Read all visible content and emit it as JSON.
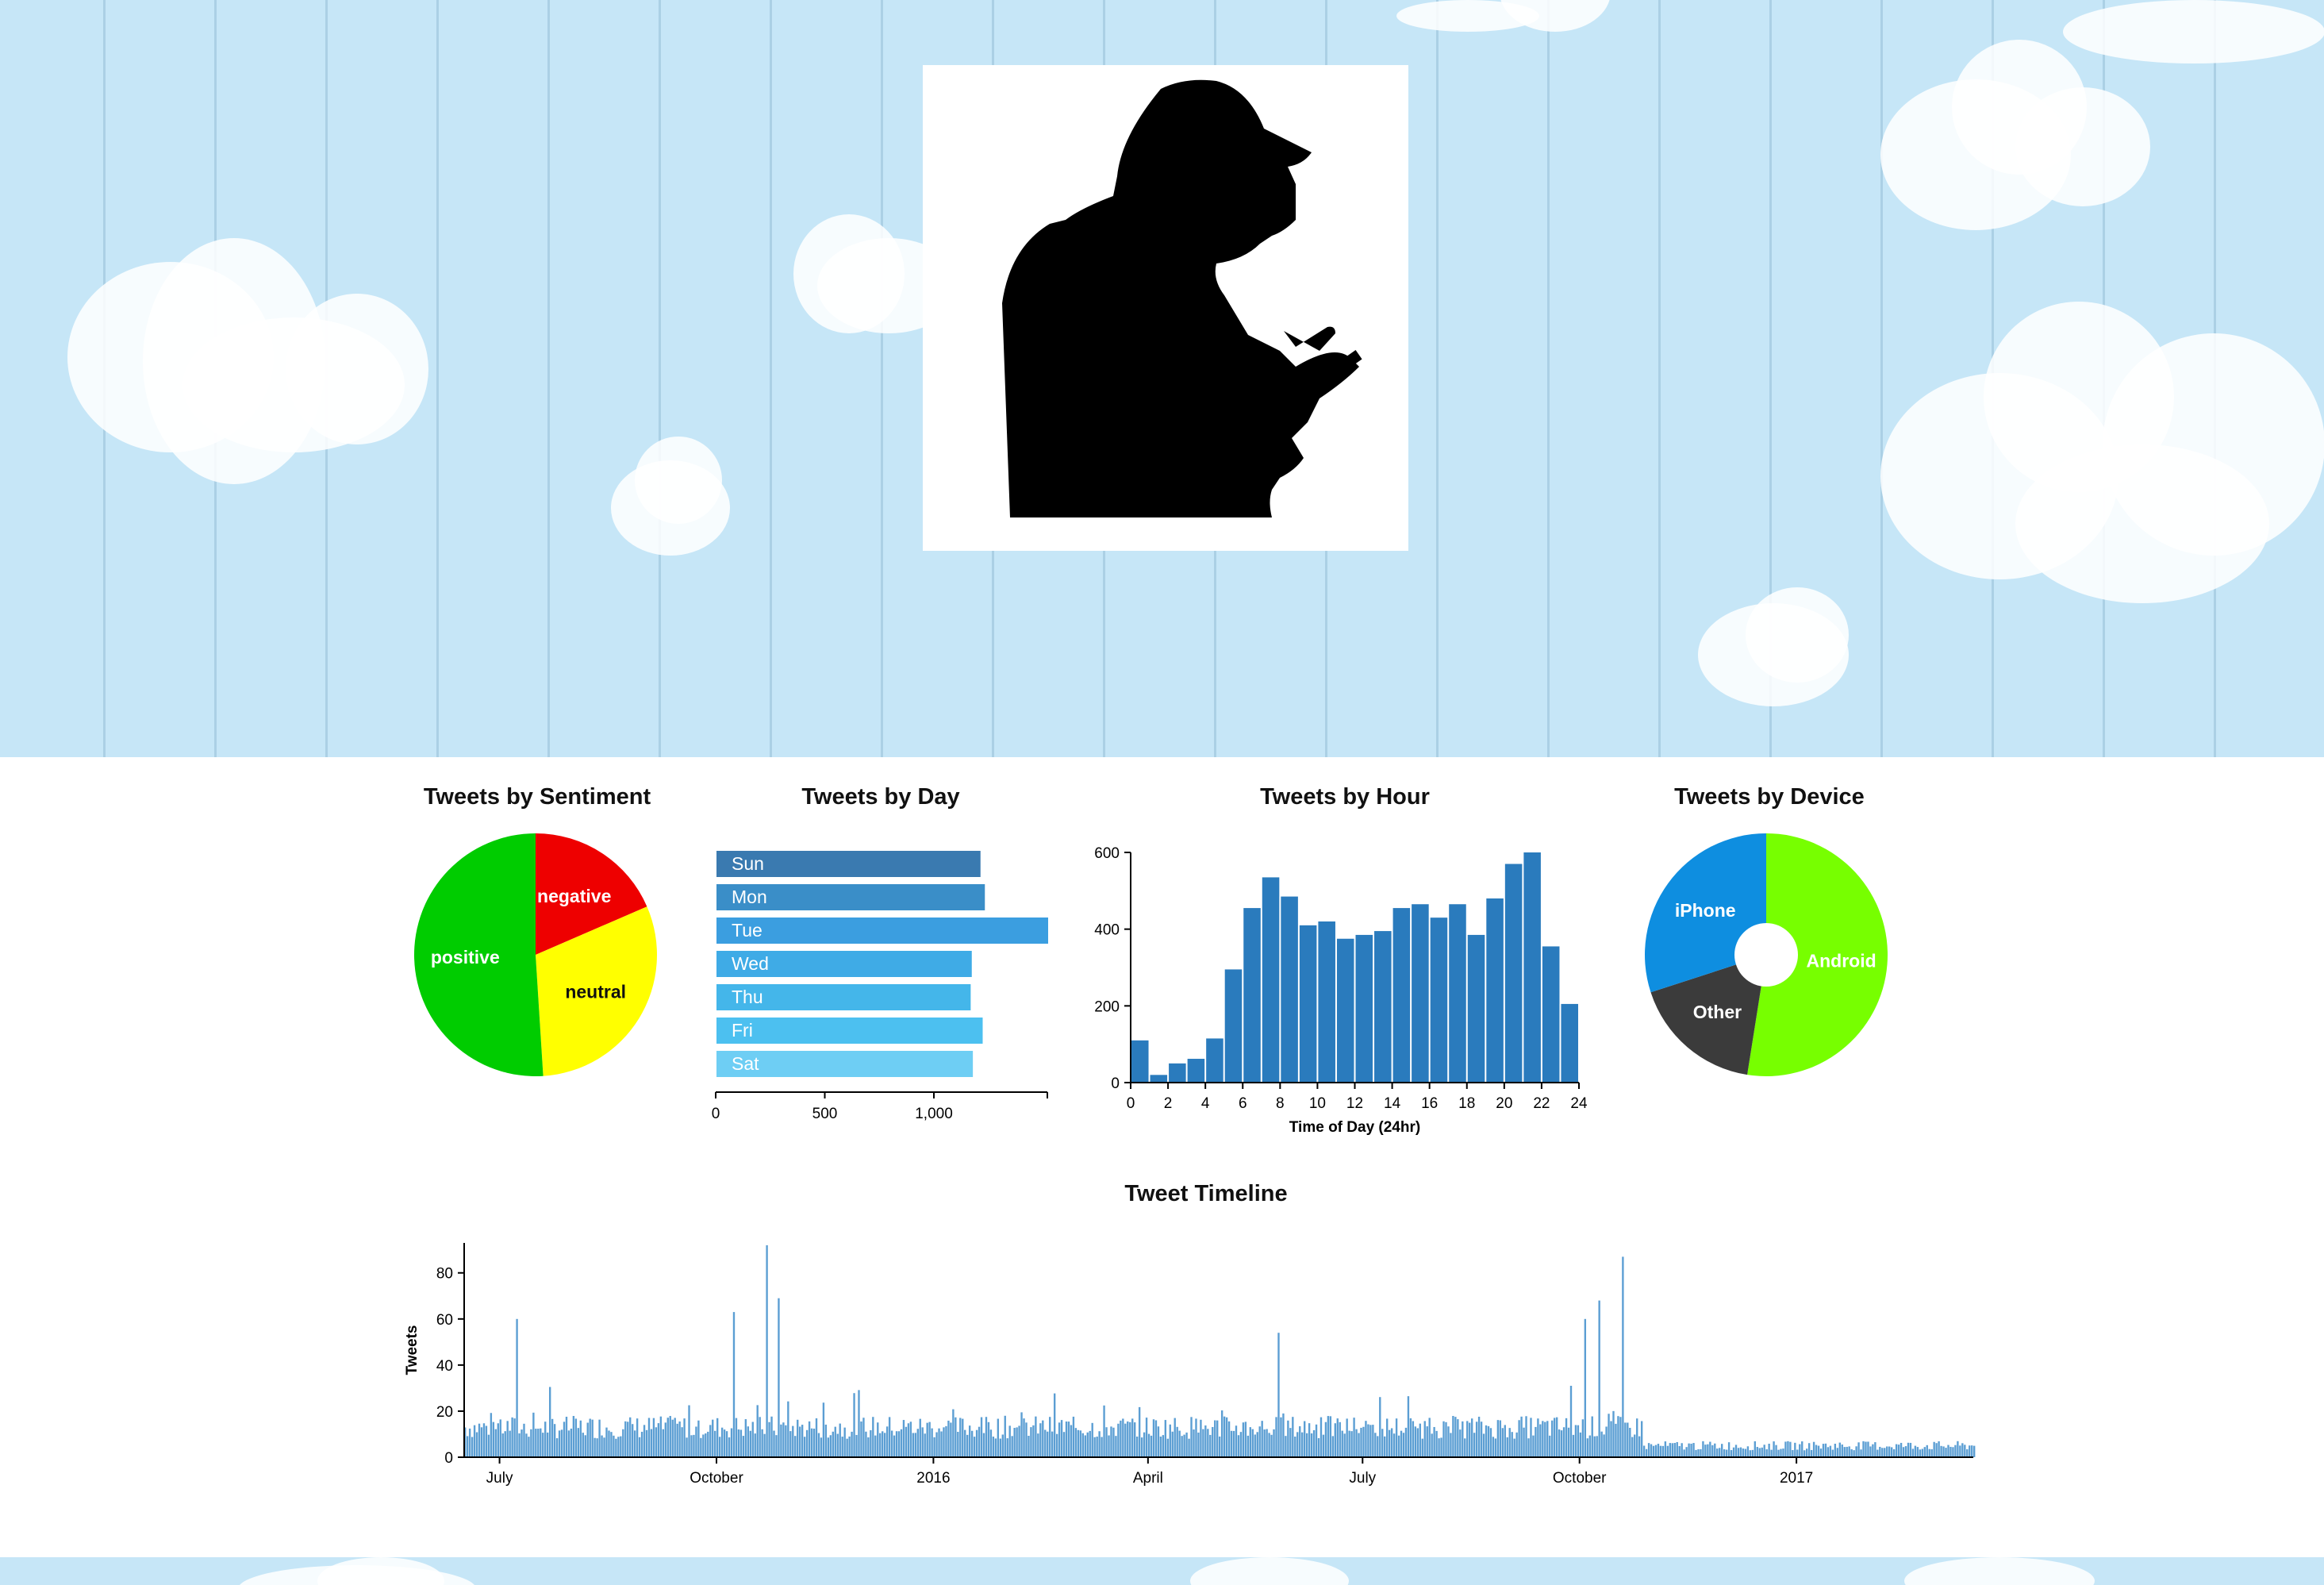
{
  "charts": {
    "sentiment": {
      "title": "Tweets by Sentiment"
    },
    "day": {
      "title": "Tweets by Day"
    },
    "hour": {
      "title": "Tweets by Hour",
      "xlabel": "Time of Day (24hr)"
    },
    "device": {
      "title": "Tweets by Device"
    },
    "timeline": {
      "title": "Tweet Timeline",
      "ylabel": "Tweets"
    }
  },
  "chart_data": [
    {
      "type": "pie",
      "title": "Tweets by Sentiment",
      "labels": [
        "negative",
        "neutral",
        "positive"
      ],
      "values": [
        18.5,
        30.5,
        51
      ],
      "colors": [
        "#ee0000",
        "#ffff00",
        "#00cc00"
      ],
      "label_colors": [
        "#ffffff",
        "#111111",
        "#ffffff"
      ]
    },
    {
      "type": "bar",
      "orientation": "horizontal",
      "title": "Tweets by Day",
      "categories": [
        "Sun",
        "Mon",
        "Tue",
        "Wed",
        "Thu",
        "Fri",
        "Sat"
      ],
      "values": [
        1210,
        1230,
        1520,
        1170,
        1165,
        1220,
        1175
      ],
      "colors": [
        "#3a7ab0",
        "#3a8ec8",
        "#3b9ee0",
        "#3fabe6",
        "#44b6ea",
        "#4cc0f0",
        "#6ecef4"
      ],
      "xticks": [
        0,
        500,
        1000
      ],
      "xtick_labels": [
        "0",
        "500",
        "1,000"
      ],
      "xlim": [
        0,
        1520
      ]
    },
    {
      "type": "bar",
      "title": "Tweets by Hour",
      "xlabel": "Time of Day (24hr)",
      "x": [
        0,
        1,
        2,
        3,
        4,
        5,
        6,
        7,
        8,
        9,
        10,
        11,
        12,
        13,
        14,
        15,
        16,
        17,
        18,
        19,
        20,
        21,
        22,
        23
      ],
      "values": [
        110,
        20,
        50,
        62,
        115,
        295,
        455,
        535,
        485,
        410,
        420,
        375,
        385,
        395,
        455,
        465,
        430,
        465,
        385,
        480,
        570,
        600,
        355,
        205
      ],
      "color": "#2a7bbd",
      "yticks": [
        0,
        200,
        400,
        600
      ],
      "xticks": [
        0,
        2,
        4,
        6,
        8,
        10,
        12,
        14,
        16,
        18,
        20,
        22,
        24
      ],
      "ylim": [
        0,
        600
      ],
      "xlim": [
        0,
        24
      ]
    },
    {
      "type": "pie",
      "style": "donut",
      "title": "Tweets by Device",
      "labels": [
        "Android",
        "Other",
        "iPhone"
      ],
      "values": [
        52.5,
        17.5,
        30
      ],
      "colors": [
        "#77ff00",
        "#3b3b3b",
        "#0e8ee0"
      ],
      "label_colors": [
        "#ffffff",
        "#ffffff",
        "#ffffff"
      ]
    },
    {
      "type": "bar",
      "title": "Tweet Timeline",
      "ylabel": "Tweets",
      "yticks": [
        0,
        20,
        40,
        60,
        80
      ],
      "ylim": [
        0,
        93
      ],
      "xtick_labels": [
        "July",
        "October",
        "2016",
        "April",
        "July",
        "October",
        "2017"
      ],
      "x_range": [
        "2015-06-16",
        "2017-03-17"
      ],
      "xtick_dates": [
        "2015-07-01",
        "2015-10-01",
        "2016-01-01",
        "2016-04-01",
        "2016-07-01",
        "2016-10-01",
        "2017-01-01"
      ],
      "color": "#5b9ed3",
      "spikes": [
        {
          "date": "2015-07-08",
          "value": 60
        },
        {
          "date": "2015-10-08",
          "value": 63
        },
        {
          "date": "2015-10-22",
          "value": 92
        },
        {
          "date": "2015-10-27",
          "value": 69
        },
        {
          "date": "2016-05-26",
          "value": 54
        },
        {
          "date": "2016-09-27",
          "value": 31
        },
        {
          "date": "2016-10-03",
          "value": 60
        },
        {
          "date": "2016-10-09",
          "value": 68
        },
        {
          "date": "2016-10-19",
          "value": 87
        }
      ]
    }
  ]
}
